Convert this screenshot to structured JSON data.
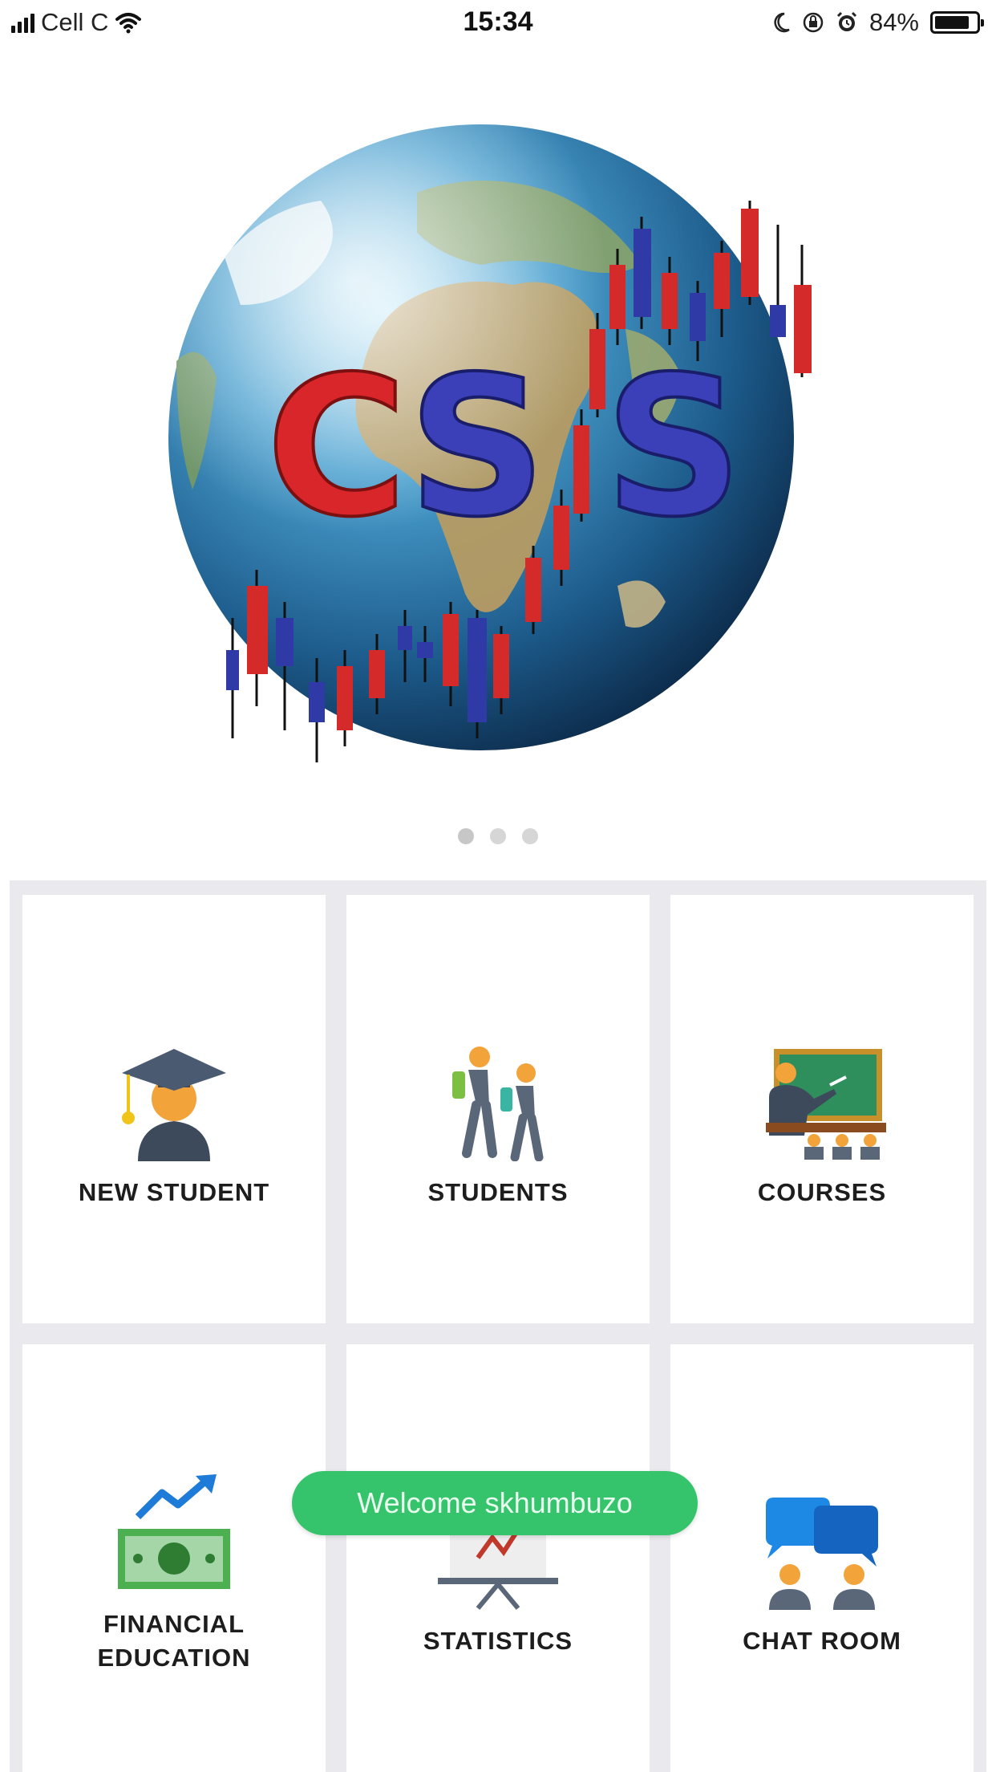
{
  "status_bar": {
    "carrier": "Cell C",
    "time": "15:34",
    "battery_percent": "84%",
    "battery_level": 0.84,
    "icons": [
      "signal-icon",
      "wifi-icon",
      "moon-icon",
      "lock-rotation-icon",
      "alarm-icon",
      "battery-icon"
    ]
  },
  "hero": {
    "logo_text": [
      "C",
      "S",
      "S"
    ],
    "logo_colors": [
      "#d8262b",
      "#3b3fb8",
      "#3b3fb8"
    ],
    "pager": {
      "count": 3,
      "active_index": 0
    }
  },
  "menu": {
    "tiles": [
      {
        "label": "NEW STUDENT",
        "icon": "graduate-icon"
      },
      {
        "label": "STUDENTS",
        "icon": "students-walking-icon"
      },
      {
        "label": "COURSES",
        "icon": "classroom-icon"
      },
      {
        "label": "FINANCIAL\nEDUCATION",
        "icon": "money-growth-icon"
      },
      {
        "label": "STATISTICS",
        "icon": "statistics-board-icon"
      },
      {
        "label": "CHAT ROOM",
        "icon": "chat-room-icon"
      }
    ]
  },
  "toast": {
    "message": "Welcome skhumbuzo"
  }
}
